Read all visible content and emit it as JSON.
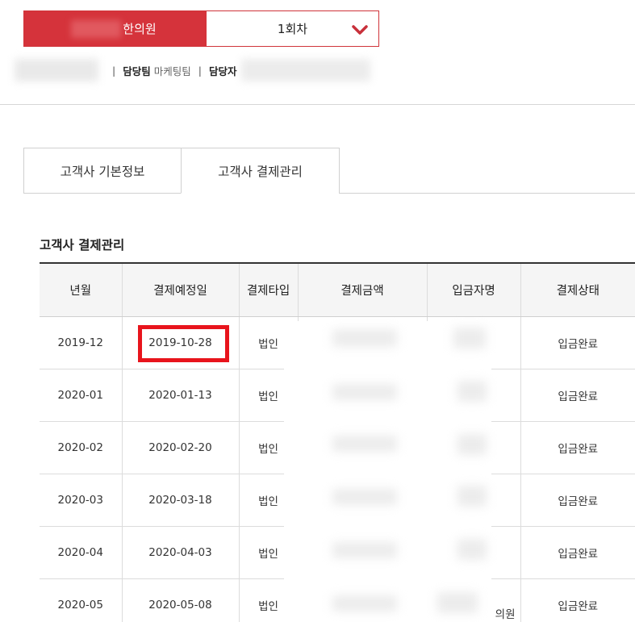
{
  "header": {
    "clinic_name": "한의원",
    "session_select": "1회차",
    "info": {
      "team_label": "담당팀",
      "team_value": "마케팅팀",
      "manager_label": "담당자"
    }
  },
  "tabs": [
    {
      "label": "고객사 기본정보",
      "active": false
    },
    {
      "label": "고객사 결제관리",
      "active": true
    }
  ],
  "section_title": "고객사 결제관리",
  "table": {
    "headers": [
      "년월",
      "결제예정일",
      "결제타입",
      "결제금액",
      "입금자명",
      "결제상태"
    ],
    "rows": [
      {
        "month": "2019-12",
        "due_date": "2019-10-28",
        "type": "법인",
        "amount": "",
        "depositor": "",
        "status": "입금완료"
      },
      {
        "month": "2020-01",
        "due_date": "2020-01-13",
        "type": "법인",
        "amount": "",
        "depositor": "",
        "status": "입금완료"
      },
      {
        "month": "2020-02",
        "due_date": "2020-02-20",
        "type": "법인",
        "amount": "",
        "depositor": "",
        "status": "입금완료"
      },
      {
        "month": "2020-03",
        "due_date": "2020-03-18",
        "type": "법인",
        "amount": "",
        "depositor": "",
        "status": "입금완료"
      },
      {
        "month": "2020-04",
        "due_date": "2020-04-03",
        "type": "법인",
        "amount": "",
        "depositor": "",
        "status": "입금완료"
      },
      {
        "month": "2020-05",
        "due_date": "2020-05-08",
        "type": "법인",
        "amount": "",
        "depositor": "의원",
        "status": "입금완료"
      }
    ]
  },
  "colors": {
    "accent": "#d5333b",
    "highlight": "#e8141c"
  }
}
